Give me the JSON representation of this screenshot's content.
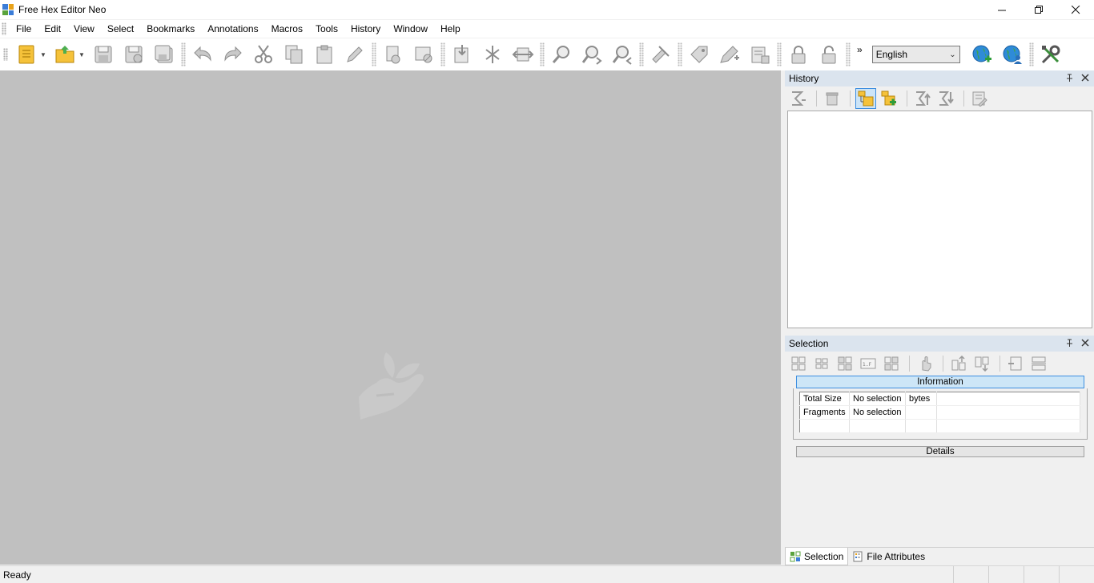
{
  "window": {
    "title": "Free Hex Editor Neo",
    "controls": [
      "minimize-icon",
      "restore-icon",
      "close-icon"
    ]
  },
  "menu": [
    "File",
    "Edit",
    "View",
    "Select",
    "Bookmarks",
    "Annotations",
    "Macros",
    "Tools",
    "History",
    "Window",
    "Help"
  ],
  "toolbar": {
    "language": "English",
    "overflow": "»"
  },
  "history_panel": {
    "title": "History"
  },
  "selection_panel": {
    "title": "Selection",
    "info_label": "Information",
    "rows": [
      {
        "label": "Total Size",
        "value": "No selection",
        "unit": "bytes"
      },
      {
        "label": "Fragments",
        "value": "No selection",
        "unit": ""
      }
    ],
    "details_label": "Details"
  },
  "bottom_tabs": [
    {
      "label": "Selection",
      "active": true
    },
    {
      "label": "File Attributes",
      "active": false
    }
  ],
  "status": {
    "text": "Ready"
  },
  "colors": {
    "editor_bg": "#c0c0c0",
    "panel_header_bg": "#dbe4ee",
    "active_tool_bg": "#cce4f7",
    "accent": "#3d8ee0"
  }
}
